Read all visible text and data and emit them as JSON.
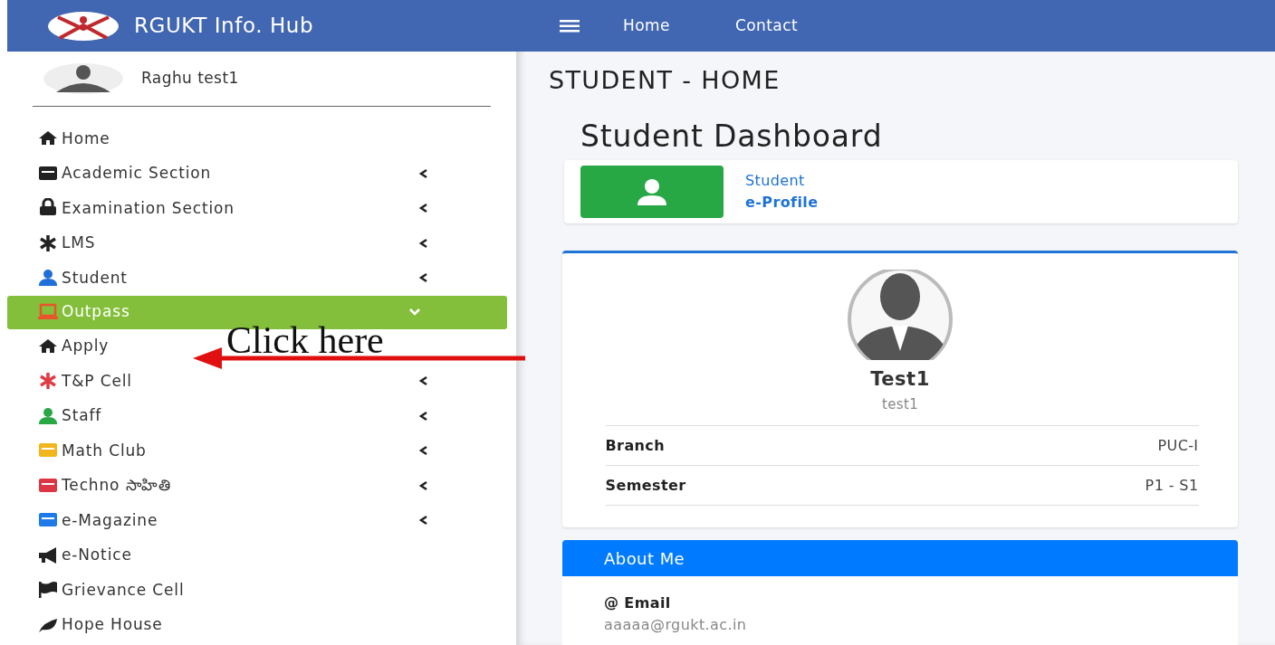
{
  "brand": {
    "title": "RGUKT Info. Hub"
  },
  "user": {
    "name": "Raghu test1"
  },
  "menu": [
    {
      "label": "Home",
      "kind": "home",
      "color": "#222222",
      "caret": false,
      "selected": false
    },
    {
      "label": "Academic Section",
      "kind": "book",
      "color": "#222222",
      "caret": true,
      "selected": false
    },
    {
      "label": "Examination Section",
      "kind": "lock",
      "color": "#222222",
      "caret": true,
      "selected": false
    },
    {
      "label": "LMS",
      "kind": "asterisk",
      "color": "#222222",
      "caret": true,
      "selected": false
    },
    {
      "label": "Student",
      "kind": "user",
      "color": "#1e6fd9",
      "caret": true,
      "selected": false
    },
    {
      "label": "Outpass",
      "kind": "laptop",
      "color": "#e8542c",
      "caret": true,
      "selected": true,
      "expanded": true,
      "children": [
        {
          "label": "Apply",
          "kind": "home",
          "color": "#222222",
          "caret": false,
          "selected": false
        }
      ]
    },
    {
      "label": "T&P Cell",
      "kind": "asterisk",
      "color": "#e03b45",
      "caret": true,
      "selected": false
    },
    {
      "label": "Staff",
      "kind": "user",
      "color": "#28a745",
      "caret": true,
      "selected": false
    },
    {
      "label": "Math Club",
      "kind": "book",
      "color": "#f2b61c",
      "caret": true,
      "selected": false
    },
    {
      "label": "Techno సాహితి",
      "kind": "book",
      "color": "#dc3545",
      "caret": true,
      "selected": false
    },
    {
      "label": "e-Magazine",
      "kind": "book",
      "color": "#1e7ae8",
      "caret": true,
      "selected": false
    },
    {
      "label": "e-Notice",
      "kind": "bullhorn",
      "color": "#222222",
      "caret": false,
      "selected": false
    },
    {
      "label": "Grievance Cell",
      "kind": "flag",
      "color": "#222222",
      "caret": false,
      "selected": false
    },
    {
      "label": "Hope House",
      "kind": "leaf",
      "color": "#222222",
      "caret": false,
      "selected": false
    }
  ],
  "topnav": [
    "Home",
    "Contact"
  ],
  "page_title": "STUDENT - HOME",
  "dashboard": {
    "heading": "Student Dashboard",
    "info_box": {
      "line1": "Student",
      "line2": "e-Profile"
    }
  },
  "profile": {
    "name": "Test1",
    "username": "test1",
    "rows": [
      {
        "label": "Branch",
        "value": "PUC-I"
      },
      {
        "label": "Semester",
        "value": "P1 - S1"
      }
    ]
  },
  "about": {
    "title": "About Me",
    "email_label": "@ Email",
    "email": "aaaaa@rgukt.ac.in"
  },
  "annotation": {
    "text": "Click here"
  }
}
